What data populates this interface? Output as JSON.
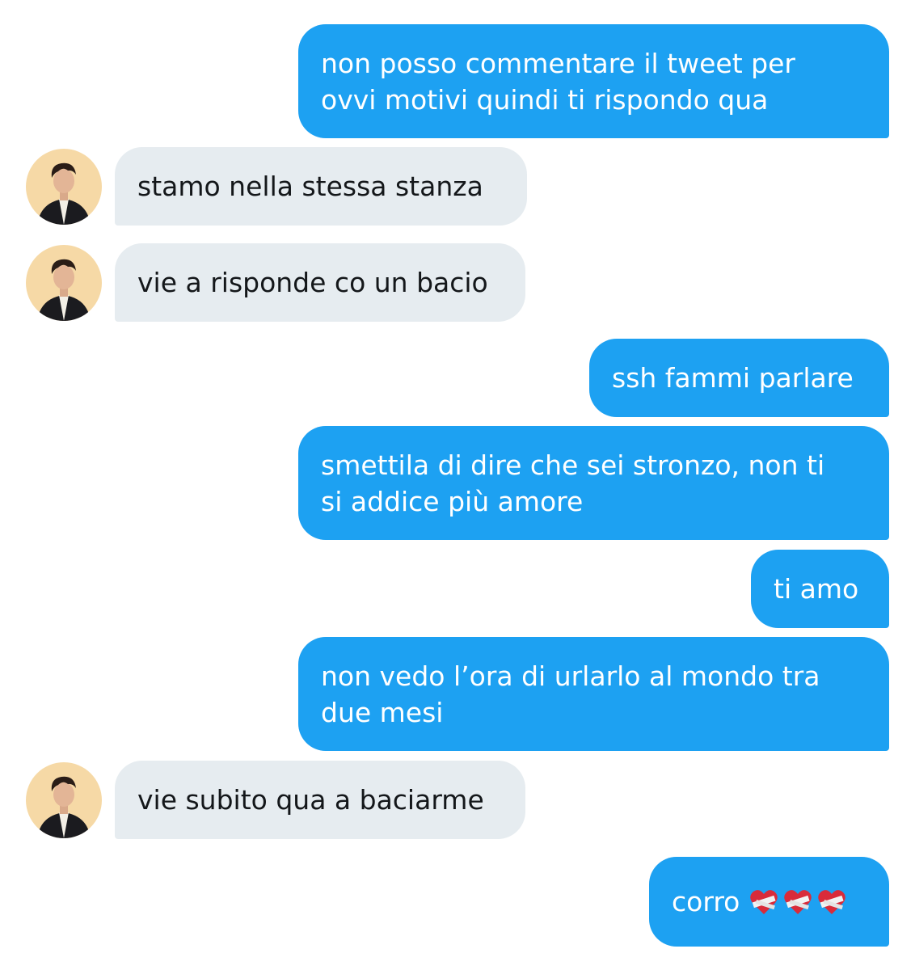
{
  "conversation": {
    "messages": [
      {
        "direction": "out",
        "text": "non posso commentare il tweet per\novvi motivi quindi ti rispondo qua"
      },
      {
        "direction": "in",
        "text": "stamo nella stessa stanza"
      },
      {
        "direction": "in",
        "text": "vie a risponde co un bacio"
      },
      {
        "direction": "out",
        "text": "ssh fammi parlare"
      },
      {
        "direction": "out",
        "text": "smettila di dire che sei stronzo, non ti\nsi addice più amore"
      },
      {
        "direction": "out",
        "text": "ti amo"
      },
      {
        "direction": "out",
        "text": "non vedo l’ora di urlarlo al mondo tra\ndue mesi"
      },
      {
        "direction": "in",
        "text": "vie subito qua a baciarme"
      },
      {
        "direction": "out",
        "text": "corro",
        "emoji": [
          "mending-heart",
          "mending-heart",
          "mending-heart"
        ]
      }
    ]
  },
  "colors": {
    "outgoing_bubble": "#1da1f2",
    "incoming_bubble": "#e6ecf0",
    "outgoing_text": "#ffffff",
    "incoming_text": "#14171a",
    "heart": "#d92b3a"
  }
}
